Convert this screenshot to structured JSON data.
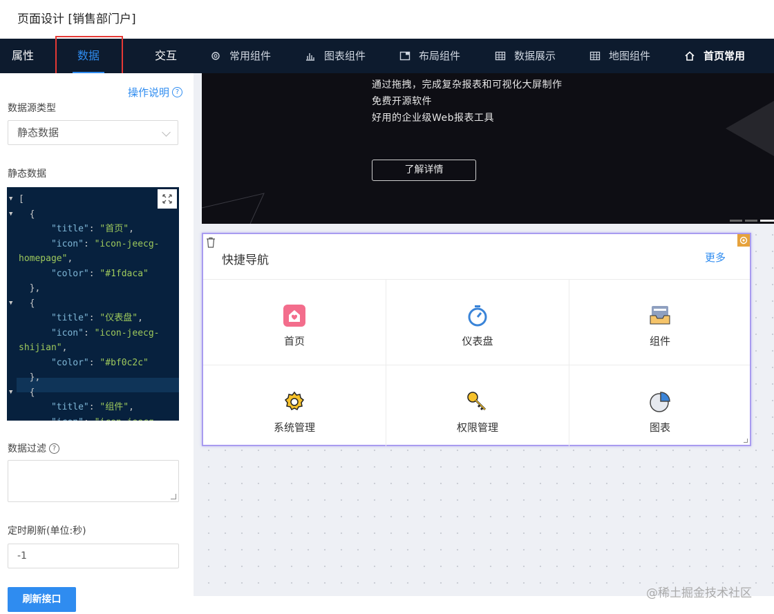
{
  "title": "页面设计 [销售部门户]",
  "nav": {
    "tabs": [
      "属性",
      "数据",
      "交互"
    ],
    "items": [
      "常用组件",
      "图表组件",
      "布局组件",
      "数据展示",
      "地图组件",
      "首页常用"
    ]
  },
  "panel": {
    "help_label": "操作说明",
    "datasource_label": "数据源类型",
    "datasource_value": "静态数据",
    "static_label": "静态数据",
    "filter_label": "数据过滤",
    "refresh_label": "定时刷新(单位:秒)",
    "refresh_value": "-1",
    "refresh_button": "刷新接口"
  },
  "json_lines": [
    "[",
    "  {",
    "      \"title\": \"首页\",",
    "      \"icon\": \"icon-jeecg-",
    "homepage\",",
    "      \"color\": \"#1fdaca\"",
    "  },",
    "  {",
    "      \"title\": \"仪表盘\",",
    "      \"icon\": \"icon-jeecg-",
    "shijian\",",
    "      \"color\": \"#bf0c2c\"",
    "  },",
    "  {",
    "      \"title\": \"组件\",",
    "      \"icon\": \"icon-jeecg-"
  ],
  "banner": {
    "lines": [
      "通过拖拽，完成复杂报表和可视化大屏制作",
      "免费开源软件",
      "好用的企业级Web报表工具"
    ],
    "button": "了解详情"
  },
  "quicknav": {
    "title": "快捷导航",
    "more": "更多",
    "items": [
      "首页",
      "仪表盘",
      "组件",
      "系统管理",
      "权限管理",
      "图表"
    ]
  },
  "watermark": "@稀土掘金技术社区",
  "colors": {
    "accent": "#2f8cf0",
    "nav_bg": "#0d1b2e",
    "highlight": "#e53935",
    "selection": "#a89bf0"
  }
}
